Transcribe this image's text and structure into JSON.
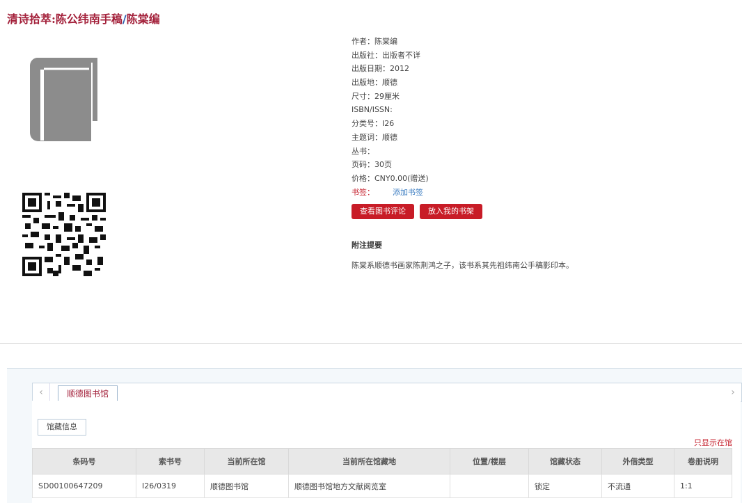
{
  "page_title": {
    "main": "清诗拾萃:陈公纬南手稿",
    "slash": "/",
    "author": "陈棠编"
  },
  "meta": {
    "author": "作者：陈棠编",
    "publisher": "出版社：出版者不详",
    "pub_date": "出版日期：2012",
    "pub_place": "出版地：顺德",
    "size": "尺寸：29厘米",
    "isbn": "ISBN/ISSN:",
    "class_no": "分类号：I26",
    "subject": "主题词：顺德",
    "series": "丛书：",
    "pages": "页码：30页",
    "price": "价格：CNY0.00(赠送)",
    "tag_label": "书签：",
    "tag_add": "添加书签"
  },
  "buttons": {
    "reviews": "查看图书评论",
    "bookshelf": "放入我的书架"
  },
  "note": {
    "heading": "附注提要",
    "text": "陈棠系顺德书画家陈荆鸿之子，该书系其先祖纬南公手稿影印本。"
  },
  "tabs": {
    "prev_glyph": "‹",
    "next_glyph": "›",
    "active": "顺德图书馆"
  },
  "subtab": "馆藏信息",
  "only_available": "只显示在馆",
  "holdings": {
    "headers": [
      "条码号",
      "索书号",
      "当前所在馆",
      "当前所在馆藏地",
      "位置/楼层",
      "馆藏状态",
      "外借类型",
      "卷册说明"
    ],
    "rows": [
      [
        "SD00100647209",
        "I26/0319",
        "顺德图书馆",
        "顺德图书馆地方文献阅览室",
        "",
        "锁定",
        "不流通",
        "1:1"
      ]
    ]
  },
  "colors": {
    "title": "#a3203a",
    "button": "#c81c27",
    "link": "#3a7cc1",
    "icon_gray": "#8c8c8c"
  },
  "icons": [
    "book-icon",
    "qr-code"
  ]
}
